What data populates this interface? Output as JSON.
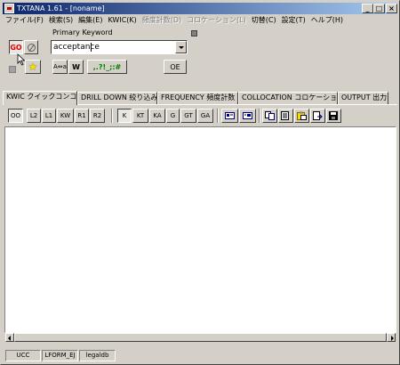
{
  "window": {
    "title": "TXTANA 1.61 - [noname]"
  },
  "menu": [
    {
      "label": "ファイル(F)",
      "disabled": false
    },
    {
      "label": "検索(S)",
      "disabled": false
    },
    {
      "label": "編集(E)",
      "disabled": false
    },
    {
      "label": "KWIC(K)",
      "disabled": false
    },
    {
      "label": "頻度計数(D)",
      "disabled": true
    },
    {
      "label": "コロケーション(L)",
      "disabled": true
    },
    {
      "label": "切替(C)",
      "disabled": false
    },
    {
      "label": "設定(T)",
      "disabled": false
    },
    {
      "label": "ヘルプ(H)",
      "disabled": false
    }
  ],
  "search": {
    "go_label": "GO",
    "keyword_label": "Primary Keyword",
    "keyword_value": "acceptance",
    "aa_label": "A⇔a",
    "w_label": "W",
    "punct_label": ",.?!_;:#",
    "oe_label": "OE"
  },
  "tabs": [
    {
      "label": "KWIC クイックコンコーダンス",
      "active": true
    },
    {
      "label": "DRILL DOWN 絞り込み",
      "active": false
    },
    {
      "label": "FREQUENCY 頻度計数",
      "active": false
    },
    {
      "label": "COLLOCATION コロケーション統計",
      "active": false
    },
    {
      "label": "OUTPUT 出力",
      "active": false
    }
  ],
  "toolbar": {
    "group1": [
      "OO",
      "L2",
      "L1",
      "KW",
      "R1",
      "R2"
    ],
    "group2": [
      "K",
      "KT",
      "KA",
      "G",
      "GT",
      "GA"
    ],
    "icons": [
      "card-view-icon",
      "card-edit-icon",
      "copy-icon",
      "list-view-icon",
      "paste-icon",
      "export-icon",
      "save-icon"
    ]
  },
  "status": [
    "UCC",
    "LFORM_EJ",
    "legaldb"
  ]
}
